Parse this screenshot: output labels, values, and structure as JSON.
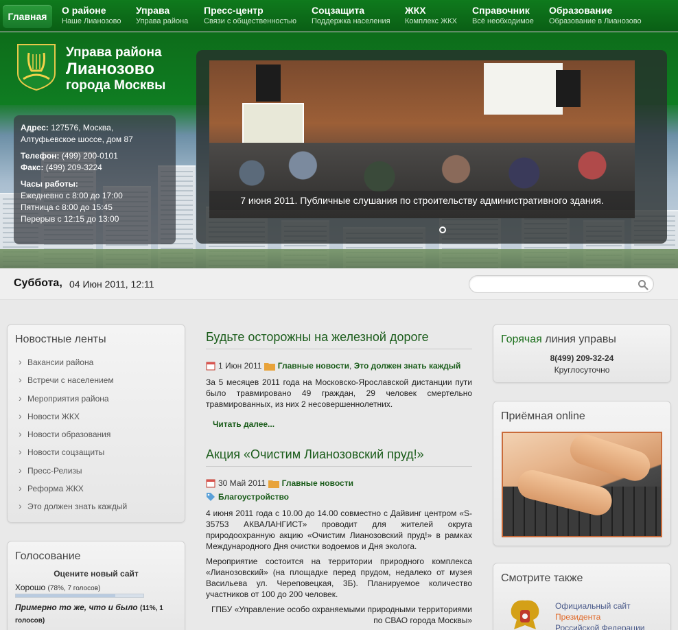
{
  "nav": {
    "home": "Главная",
    "items": [
      {
        "title": "О районе",
        "sub": "Наше Лианозово"
      },
      {
        "title": "Управа",
        "sub": "Управа района"
      },
      {
        "title": "Пресс-центр",
        "sub": "Связи с общественностью"
      },
      {
        "title": "Соцзащита",
        "sub": "Поддержка населения"
      },
      {
        "title": "ЖКХ",
        "sub": "Комплекс ЖКХ"
      },
      {
        "title": "Справочник",
        "sub": "Всё необходимое"
      },
      {
        "title": "Образование",
        "sub": "Образование в Лианозово"
      }
    ]
  },
  "header": {
    "title_line1": "Управа района",
    "title_line2": "Лианозово",
    "title_line3": "города Москвы",
    "contacts": {
      "address_label": "Адрес:",
      "address_1": "127576, Москва,",
      "address_2": "Алтуфьевское шоссе, дом 87",
      "phone_label": "Телефон:",
      "phone": "(499) 200-0101",
      "fax_label": "Факс:",
      "fax": "(499) 209-3224",
      "hours_label": "Часы работы:",
      "hours_1": "Ежедневно с 8:00 до 17:00",
      "hours_2": "Пятница с 8:00 до 15:45",
      "hours_3": "Перерыв с 12:15 до 13:00"
    },
    "slider_caption": "7 июня 2011. Публичные слушания по строительству административного здания."
  },
  "datebar": {
    "weekday": "Суббота,",
    "datetime": "04 Июн 2011, 12:11",
    "search_placeholder": ""
  },
  "feeds": {
    "title": "Новостные ленты",
    "items": [
      "Вакансии района",
      "Встречи с населением",
      "Мероприятия района",
      "Новости ЖКХ",
      "Новости образования",
      "Новости соцзащиты",
      "Пресс-Релизы",
      "Реформа ЖКХ",
      "Это должен знать каждый"
    ]
  },
  "vote": {
    "title": "Голосование",
    "question": "Оцените новый сайт",
    "opt1_label": "Хорошо",
    "opt1_stat": "(78%, 7 голосов)",
    "opt1_pct": 0.78,
    "opt2_label": "Примерно то же, что и было",
    "opt2_stat": "(11%, 1 голосов)"
  },
  "articles": [
    {
      "title": "Будьте осторожны на железной дороге",
      "date": "1 Июн 2011",
      "cat1": "Главные новости",
      "sep": ",",
      "cat2": "Это должен знать каждый",
      "text": "За 5 месяцев 2011 года на Московско-Ярославской дистанции пути было травмировано 49 граждан, 29 человек смертельно травмированных, из них 2 несовершеннолетних.",
      "readmore": "Читать далее..."
    },
    {
      "title": "Акция «Очистим Лианозовский пруд!»",
      "date": "30 Май 2011",
      "cat1": "Главные новости",
      "tag": "Благоустройство",
      "p1": "4 июня 2011 года с 10.00 до 14.00 совместно с Дайвинг центром «S-35753 АКВАЛАНГИСТ» проводит для жителей округа природоохранную акцию «Очистим Лианозовский пруд!» в рамках Международного Дня очистки водоемов и Дня эколога.",
      "p2": "Мероприятие состоится на территории природного комплекса «Лианозовский» (на площадке перед прудом, недалеко от музея Васильева ул. Череповецкая, 3Б). Планируемое количество участников от 100 до 200 человек.",
      "source": "ГПБУ «Управление особо охраняемыми природными территориями по СВАО города Москвы»"
    }
  ],
  "hotline": {
    "title_a": "Горячая",
    "title_b": " линия управы",
    "phone": "8(499) 209-32-24",
    "hours": "Круглосуточно"
  },
  "reception": {
    "title": "Приёмная online"
  },
  "seealso": {
    "title": "Смотрите также",
    "line1": "Официальный сайт",
    "line2": "Президента",
    "line3": "Российской Федерации"
  },
  "colors": {
    "nav_bg": "#0f7a1d",
    "link_green": "#1a5c1a",
    "accent_orange": "#e06a2a"
  }
}
